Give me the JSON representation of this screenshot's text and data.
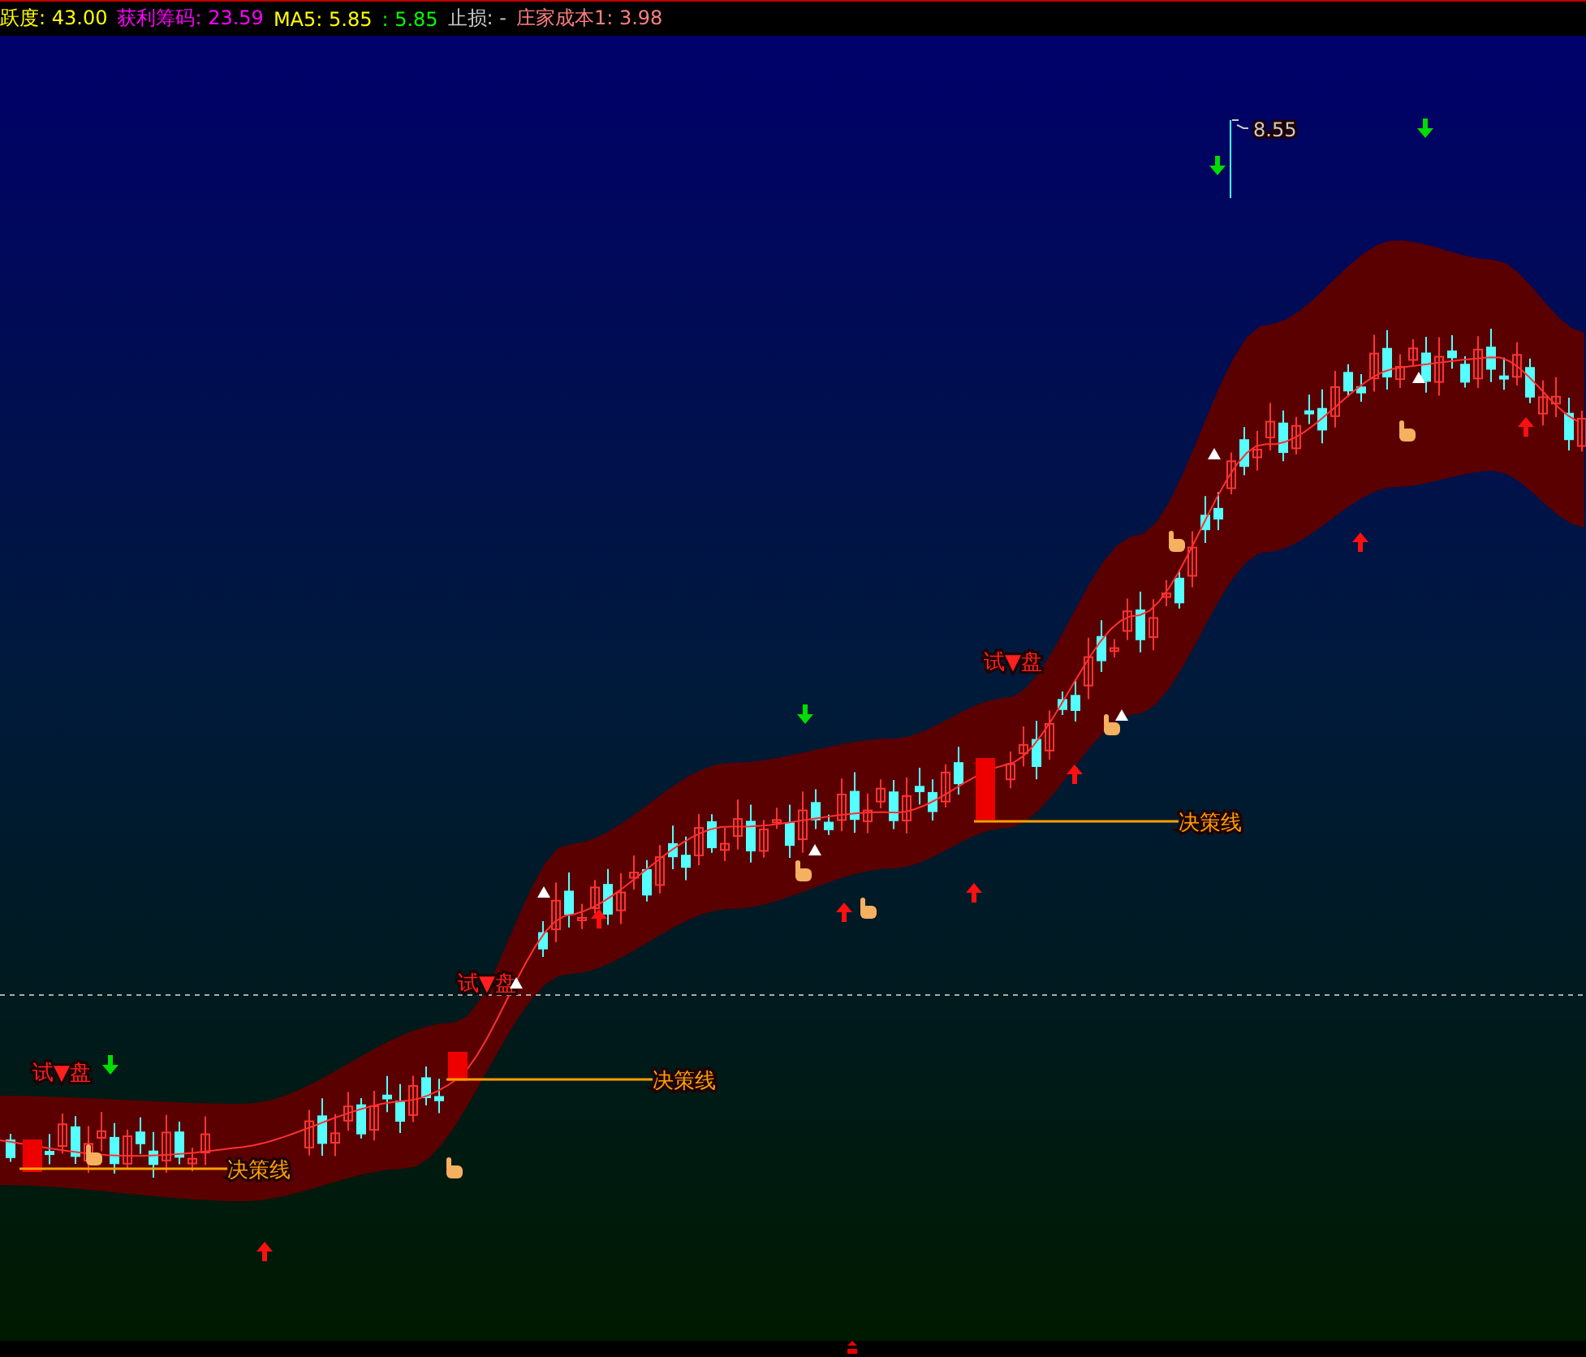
{
  "header": [
    {
      "text": "跃度: 43.00",
      "color": "#ffff00"
    },
    {
      "text": "获利筹码: 23.59",
      "color": "#ff00ff"
    },
    {
      "text": "MA5: 5.85",
      "color": "#ffff00"
    },
    {
      "text": ": 5.85",
      "color": "#00ff00"
    },
    {
      "text": "止损: -",
      "color": "#c8c8c8"
    },
    {
      "text": "庄家成本1: 3.98",
      "color": "#ff8080"
    }
  ],
  "chart": {
    "signal_labels": [
      "试▼盘",
      "试▼盘",
      "试▼盘"
    ],
    "decision_lines": [
      "决策线",
      "决策线",
      "决策线"
    ],
    "peak_price": "8.55"
  }
}
